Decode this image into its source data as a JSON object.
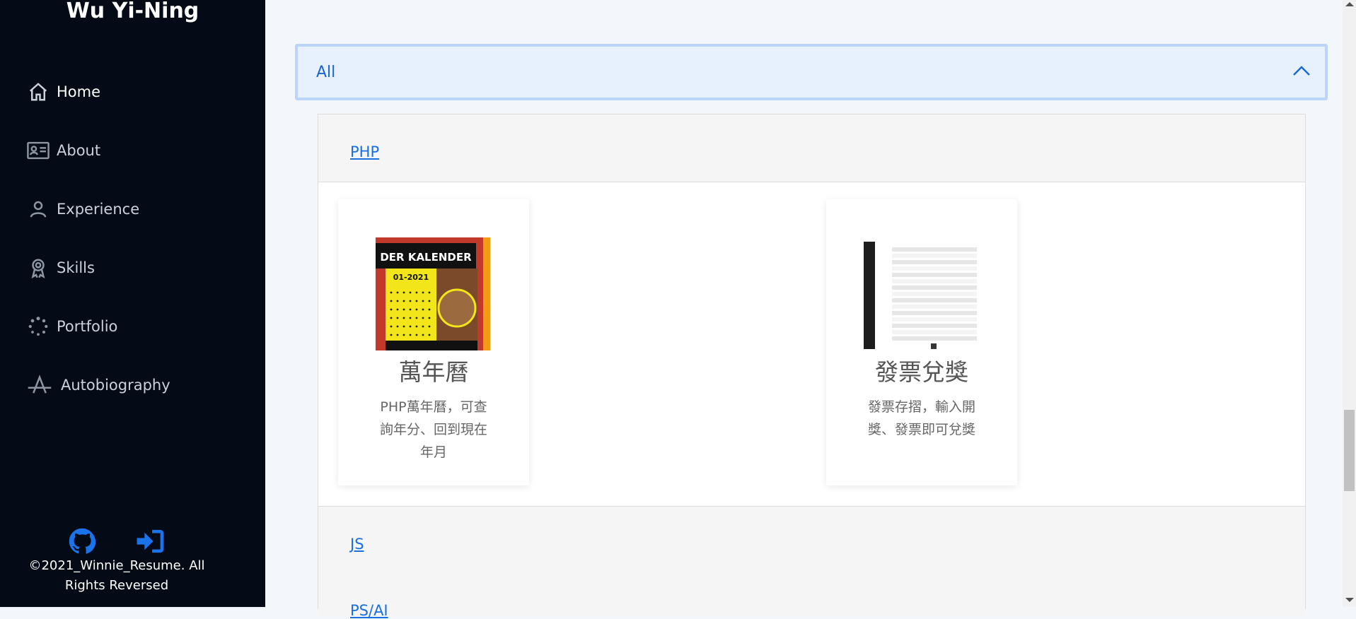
{
  "sidebar": {
    "brand": "Wu Yi-Ning",
    "items": [
      {
        "label": "Home",
        "icon": "home-icon"
      },
      {
        "label": "About",
        "icon": "id-card-icon"
      },
      {
        "label": "Experience",
        "icon": "person-icon"
      },
      {
        "label": "Skills",
        "icon": "award-icon"
      },
      {
        "label": "Portfolio",
        "icon": "loading-dots-icon"
      },
      {
        "label": "Autobiography",
        "icon": "font-a-icon"
      }
    ],
    "social": [
      {
        "icon": "github-icon"
      },
      {
        "icon": "sign-in-icon"
      }
    ],
    "copyright": "©2021_Winnie_Resume. All Rights Reversed"
  },
  "main": {
    "accordion": {
      "title": "All",
      "icon": "chevron-up-icon"
    },
    "categories": [
      "PHP",
      "JS",
      "PS/AI"
    ],
    "cards": [
      {
        "title": "萬年曆",
        "description": "PHP萬年曆，可查詢年分、回到現在年月",
        "thumb_text": "DER KALENDER",
        "thumb_date": "01-2021"
      },
      {
        "title": "發票兌獎",
        "description": "發票存摺，輸入開獎、發票即可兌獎"
      }
    ]
  },
  "colors": {
    "sidebar_bg": "#040b16",
    "accent": "#1a6fe0",
    "accordion_bg": "#e7f1fd"
  }
}
